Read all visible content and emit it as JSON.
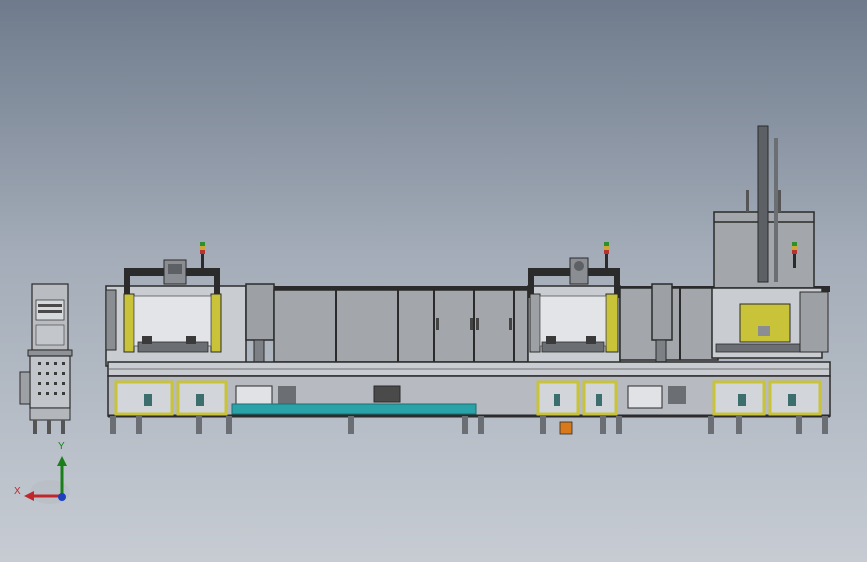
{
  "viewport": {
    "background_top": "#6f7b8c",
    "background_bottom": "#c7ccd3"
  },
  "model": {
    "frame_color": "#2b2b2b",
    "panel_color": "#a3a6ab",
    "guard_yellow": "#c9c33a",
    "conveyor_teal": "#2aa3a8",
    "accent_orange": "#d97a1a"
  },
  "triad": {
    "x_label": "X",
    "y_label": "Y",
    "x_color": "#c0272d",
    "y_color": "#1a7f1a",
    "z_color": "#1f3fbf"
  }
}
